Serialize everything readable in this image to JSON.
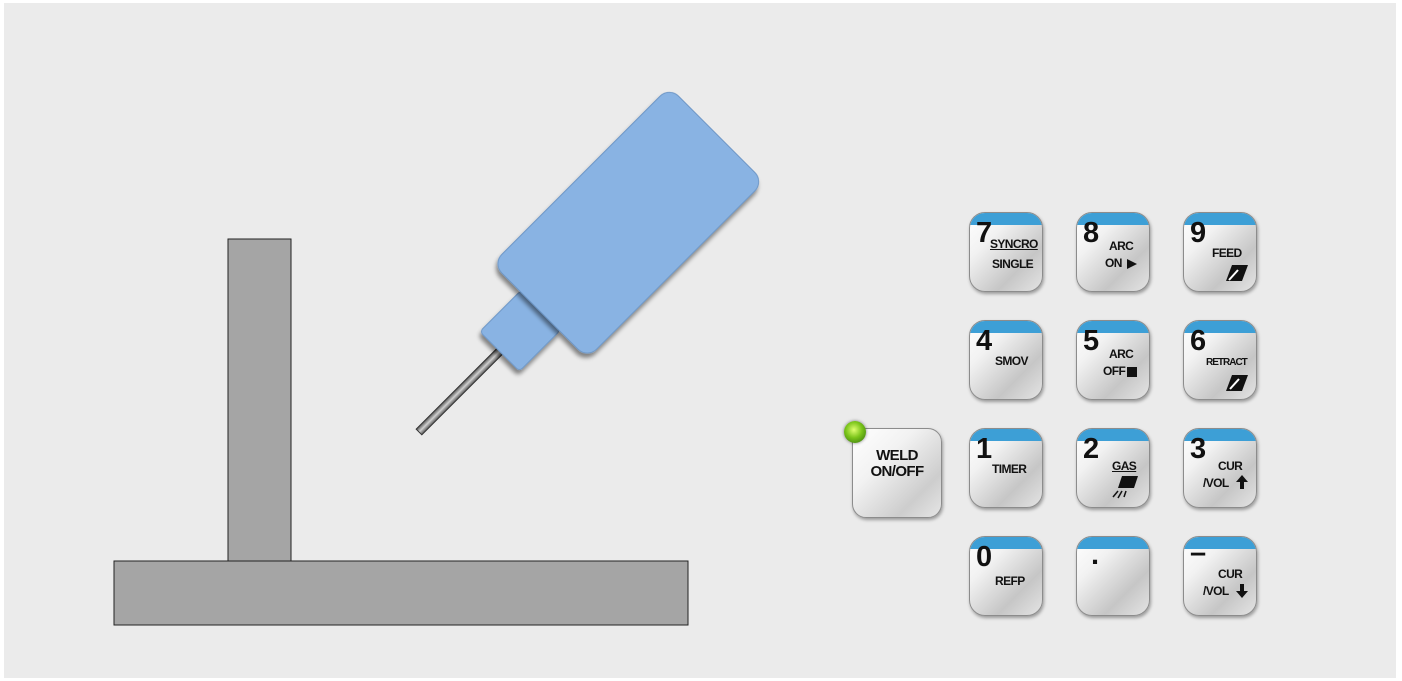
{
  "colors": {
    "panel": "#ebebeb",
    "workpiece": "#a5a5a5",
    "torch": "#89b3e3",
    "key_band": "#3d9fd6",
    "led": "#7ac41a"
  },
  "weld_button": {
    "line1": "WELD",
    "line2": "ON/OFF",
    "led_state": "on"
  },
  "keypad": {
    "k7": {
      "num": "7",
      "top": "SYNCRO",
      "bottom": "SINGLE"
    },
    "k8": {
      "num": "8",
      "line1": "ARC",
      "line2": "ON",
      "icon": "play-icon"
    },
    "k9": {
      "num": "9",
      "label": "FEED",
      "icon": "feed-arrow-icon"
    },
    "k4": {
      "num": "4",
      "label": "SMOV"
    },
    "k5": {
      "num": "5",
      "line1": "ARC",
      "line2": "OFF",
      "icon": "stop-icon"
    },
    "k6": {
      "num": "6",
      "label": "RETRACT",
      "icon": "retract-arrow-icon"
    },
    "k1": {
      "num": "1",
      "label": "TIMER"
    },
    "k2": {
      "num": "2",
      "label": "GAS",
      "icon": "gas-nozzle-icon"
    },
    "k3": {
      "num": "3",
      "line1": "CUR",
      "line2": "/VOL",
      "icon": "arrow-up-icon"
    },
    "k0": {
      "num": "0",
      "label": "REFP"
    },
    "kdot": {
      "num": "."
    },
    "kminus": {
      "num": "–",
      "line1": "CUR",
      "line2": "/VOL",
      "icon": "arrow-down-icon"
    }
  }
}
